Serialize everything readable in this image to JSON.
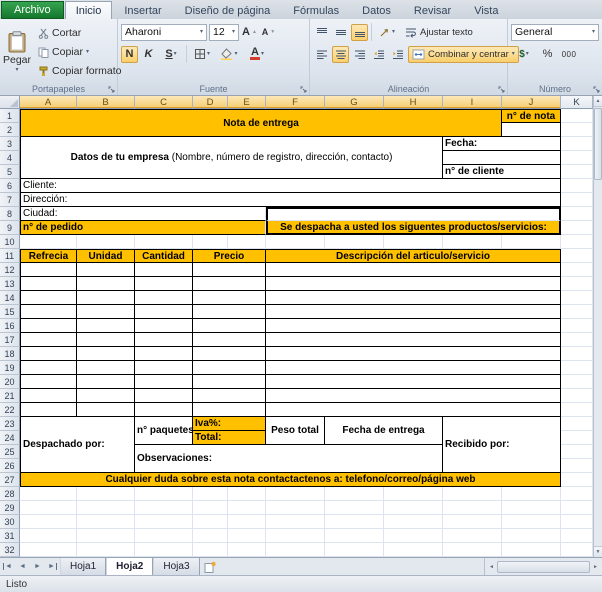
{
  "colors": {
    "accent_yellow": "#ffc000",
    "archivo_green": "#15782d",
    "selected_header": "#f5cd70"
  },
  "icons": {
    "dropdown": "▾",
    "up": "▲",
    "down": "▼",
    "letter": "A",
    "left": "◄",
    "right": "►"
  },
  "ribbon": {
    "tabs": [
      {
        "label": "Archivo"
      },
      {
        "label": "Inicio"
      },
      {
        "label": "Insertar"
      },
      {
        "label": "Diseño de página"
      },
      {
        "label": "Fórmulas"
      },
      {
        "label": "Datos"
      },
      {
        "label": "Revisar"
      },
      {
        "label": "Vista"
      }
    ],
    "clipboard": {
      "label": "Portapapeles",
      "paste": "Pegar",
      "cut": "Cortar",
      "copy": "Copiar",
      "format_painter": "Copiar formato"
    },
    "font": {
      "label": "Fuente",
      "name": "Aharoni",
      "size": "12",
      "bold": "N",
      "italic": "K",
      "underline": "S"
    },
    "alignment": {
      "label": "Alineación",
      "wrap": "Ajustar texto",
      "merge": "Combinar y centrar"
    },
    "number": {
      "label": "Número",
      "format": "General",
      "currency": "$",
      "percent": "%",
      "thousands": "000"
    }
  },
  "grid": {
    "columns": [
      "A",
      "B",
      "C",
      "D",
      "E",
      "F",
      "G",
      "H",
      "I",
      "J",
      "K"
    ],
    "rows": [
      "1",
      "2",
      "3",
      "4",
      "5",
      "6",
      "7",
      "8",
      "9",
      "10",
      "11",
      "12",
      "13",
      "14",
      "15",
      "16",
      "17",
      "18",
      "19",
      "20",
      "21",
      "22",
      "23",
      "24",
      "25",
      "26",
      "27",
      "28",
      "29",
      "30",
      "31",
      "32"
    ],
    "cells": {
      "title": "Nota de entrega",
      "note_number": "n° de nota",
      "company_bold": "Datos de tu empresa",
      "company_tail": " (Nombre, número de registro, dirección, contacto)",
      "date_label": "Fecha:",
      "client_number": "n° de cliente",
      "client": "Cliente:",
      "address": "Dirección:",
      "city": "Ciudad:",
      "order_number": "n° de pedido",
      "dispatch": "Se despacha a usted los siguentes productos/servicios:",
      "table_headers": [
        "Refrecia",
        "Unidad",
        "Cantidad",
        "Precio",
        "Descripción del articulo/servicio"
      ],
      "dispatched_by": "Despachado por:",
      "packages": "n° paquetes",
      "iva": "Iva%:",
      "total": "Total:",
      "weight": "Peso total",
      "delivery_date": "Fecha de entrega",
      "received_by": "Recibido por:",
      "observations": "Observaciones:",
      "footer": "Cualquier duda sobre esta nota contactactenos a: telefono/correo/página web"
    }
  },
  "sheet_tabs": {
    "items": [
      {
        "label": "Hoja1"
      },
      {
        "label": "Hoja2"
      },
      {
        "label": "Hoja3"
      }
    ]
  },
  "status": {
    "ready": "Listo"
  }
}
